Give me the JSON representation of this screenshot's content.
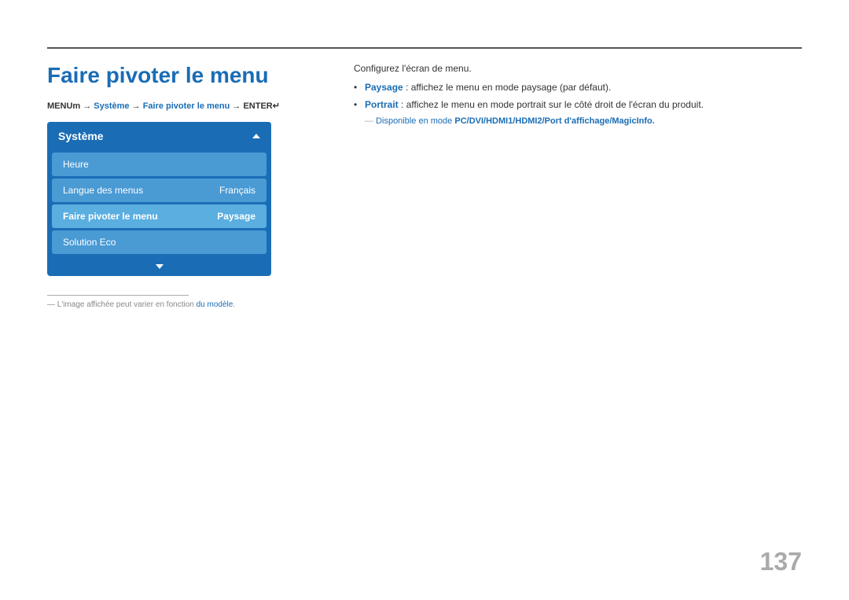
{
  "page": {
    "title": "Faire pivoter le menu",
    "page_number": "137"
  },
  "breadcrumb": {
    "prefix": "MENU",
    "symbol_menu": "☰",
    "arrow1": " → ",
    "nav1": "Système",
    "arrow2": " → ",
    "nav2": "Faire pivoter le menu",
    "arrow3": " → ",
    "nav3": "ENTER",
    "symbol_enter": "↵"
  },
  "menu": {
    "header": "Système",
    "items": [
      {
        "label": "Heure",
        "value": "",
        "active": false
      },
      {
        "label": "Langue des menus",
        "value": "Français",
        "active": false
      },
      {
        "label": "Faire pivoter le menu",
        "value": "Paysage",
        "active": true
      },
      {
        "label": "Solution Eco",
        "value": "",
        "active": false
      }
    ]
  },
  "right": {
    "config_text": "Configurez l'écran de menu.",
    "bullets": [
      {
        "term": "Paysage",
        "term_colon": " : ",
        "rest": "affichez le menu en mode paysage (par défaut)."
      },
      {
        "term": "Portrait",
        "term_colon": " : ",
        "rest": "affichez le menu en mode portrait sur le côté droit de l'écran du produit."
      }
    ],
    "available_note": "Disponible en mode ",
    "available_modes": "PC/DVI/HDMI1/HDMI2/Port d'affichage/MagicInfo."
  },
  "footnote": {
    "dash": "―",
    "text": " L'image affichée peut varier en fonction du modèle.",
    "highlight": "du modèle"
  }
}
